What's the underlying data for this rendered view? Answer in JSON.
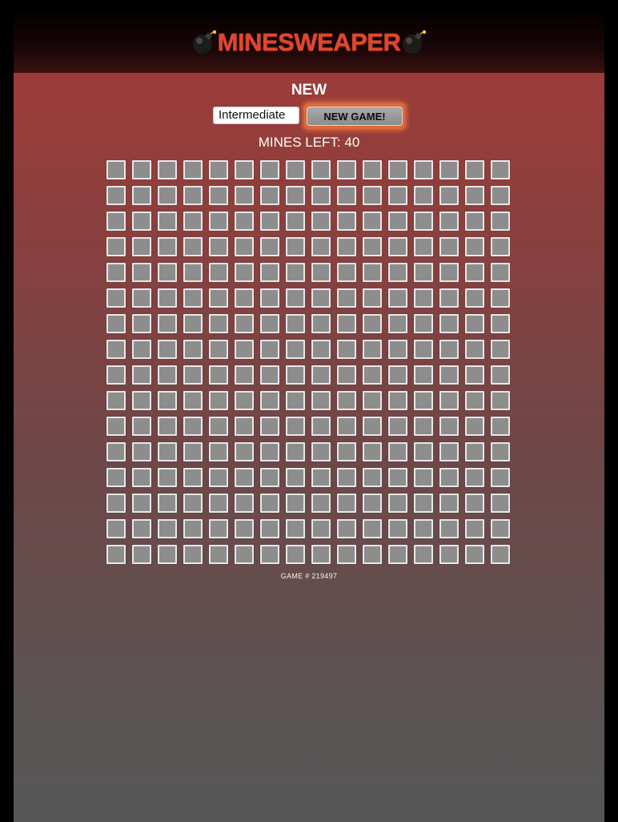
{
  "app": {
    "title_text": "MINESWEAPER",
    "icon": "bomb-icon",
    "accent_color": "#e2452e"
  },
  "controls": {
    "section_title": "NEW",
    "difficulty_value": "Intermediate",
    "new_game_label": "NEW GAME!"
  },
  "status": {
    "mines_left": "MINES LEFT: 40"
  },
  "board": {
    "rows": 16,
    "cols": 16,
    "cell_state": "covered"
  },
  "footer": {
    "game_number": "GAME # 219497"
  }
}
